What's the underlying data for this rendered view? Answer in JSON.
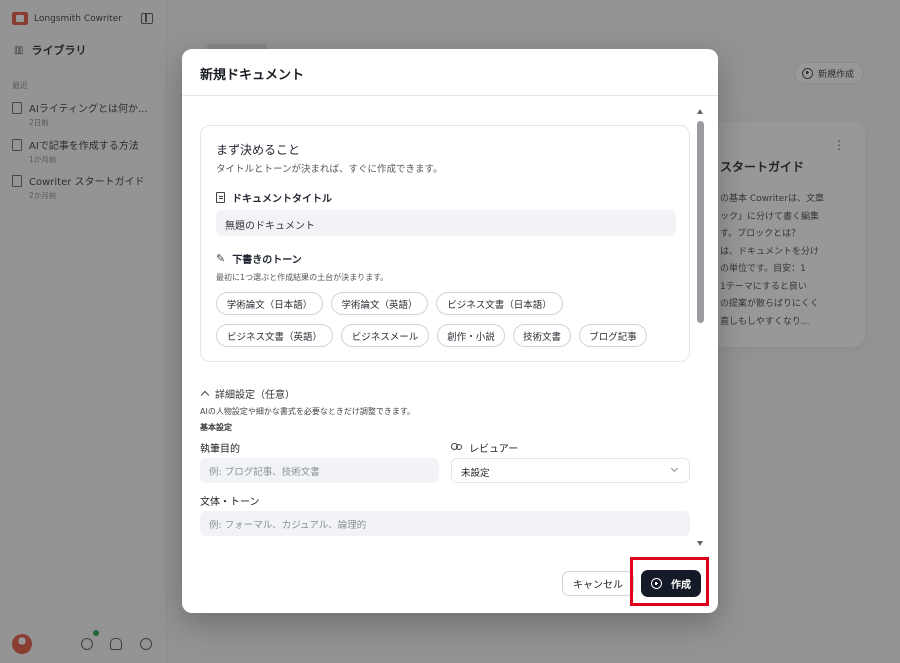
{
  "app": {
    "brand": "Longsmith Cowriter"
  },
  "sidebar": {
    "library_label": "ライブラリ",
    "recent_label": "最近",
    "docs": [
      {
        "title": "AIライティングとは何か...",
        "meta": "2日前"
      },
      {
        "title": "AIで記事を作成する方法",
        "meta": "1か月前"
      },
      {
        "title": "Cowriter スタートガイド",
        "meta": "2か月前"
      }
    ]
  },
  "main": {
    "new_button": "新規作成",
    "card": {
      "title": "スタートガイド",
      "body": "の基本 Cowriterは、文章\nック」に分けて書く編集\nす。ブロックとは？\nは、ドキュメントを分け\nの単位です。目安：1\n1テーマにすると良い\nの提案が散らばりにくく\n直しもしやすくなり..."
    }
  },
  "modal": {
    "title": "新規ドキュメント",
    "decide": {
      "title": "まず決めること",
      "subtitle": "タイトルとトーンが決まれば、すぐに作成できます。"
    },
    "doc_title": {
      "label": "ドキュメントタイトル",
      "value": "無題のドキュメント"
    },
    "tone": {
      "label": "下書きのトーン",
      "subtitle": "最初に1つ選ぶと作成結果の土台が決まります。",
      "options": [
        "学術論文（日本語）",
        "学術論文（英語）",
        "ビジネス文書（日本語）",
        "ビジネス文書（英語）",
        "ビジネスメール",
        "創作・小説",
        "技術文書",
        "ブログ記事"
      ]
    },
    "advanced": {
      "toggle_label": "詳細設定（任意）",
      "subtitle": "AIの人物設定や細かな書式を必要なときだけ調整できます。",
      "basic_label": "基本設定",
      "purpose_label": "執筆目的",
      "purpose_placeholder": "例: ブログ記事、技術文書",
      "reviewer_label": "レビュアー",
      "reviewer_value": "未設定",
      "style_label": "文体・トーン",
      "style_placeholder": "例: フォーマル、カジュアル、論理的"
    },
    "cancel_label": "キャンセル",
    "create_label": "作成"
  },
  "colors": {
    "primary": "#141a28",
    "highlight": "#e0001b",
    "brand": "#e2543a"
  }
}
